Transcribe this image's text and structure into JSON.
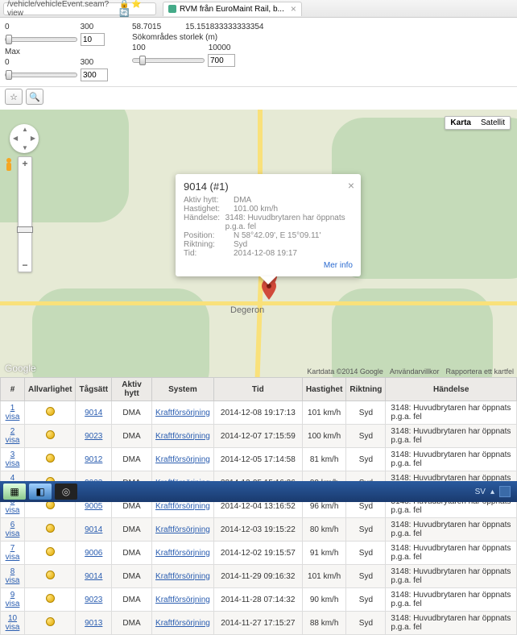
{
  "browser": {
    "url": "/vehicle/vehicleEvent.seam?view",
    "tab_title": "RVM från EuroMaint Rail, b..."
  },
  "controls": {
    "range1_min": "0",
    "range1_max": "300",
    "max_label": "Max",
    "range2_min": "0",
    "range2_max": "300",
    "small_box1": "10",
    "small_box2": "300",
    "area_label": "Sökområdes storlek (m)",
    "area_min": "100",
    "area_max": "10000",
    "area_val": "700",
    "coord_top": "58.7015",
    "coord_top2": "15.151833333333354"
  },
  "map": {
    "type_map": "Karta",
    "type_sat": "Satellit",
    "place": "Degeron",
    "logo": "Google",
    "footer_data": "Kartdata ©2014 Google",
    "footer_terms": "Användarvillkor",
    "footer_report": "Rapportera ett kartfel"
  },
  "info": {
    "title": "9014 (#1)",
    "k_hytt": "Aktiv hytt:",
    "v_hytt": "DMA",
    "k_speed": "Hastighet:",
    "v_speed": "101.00 km/h",
    "k_event": "Händelse:",
    "v_event": "3148: Huvudbrytaren har öppnats p.g.a. fel",
    "k_pos": "Position:",
    "v_pos": "N 58°42.09', E 15°09.11'",
    "k_dir": "Riktning:",
    "v_dir": "Syd",
    "k_time": "Tid:",
    "v_time": "2014-12-08 19:17",
    "more": "Mer info"
  },
  "table": {
    "headers": {
      "num": "#",
      "sev": "Allvarlighet",
      "tag": "Tågsätt",
      "hytt": "Aktiv hytt",
      "sys": "System",
      "tid": "Tid",
      "hast": "Hastighet",
      "rikt": "Riktning",
      "hand": "Händelse"
    },
    "rows": [
      {
        "n": "1 visa",
        "tag": "9014",
        "hytt": "DMA",
        "sys": "Kraftförsörjning",
        "tid": "2014-12-08 19:17:13",
        "hast": "101 km/h",
        "rikt": "Syd",
        "hand": "3148: Huvudbrytaren har öppnats p.g.a. fel"
      },
      {
        "n": "2 visa",
        "tag": "9023",
        "hytt": "DMA",
        "sys": "Kraftförsörjning",
        "tid": "2014-12-07 17:15:59",
        "hast": "100 km/h",
        "rikt": "Syd",
        "hand": "3148: Huvudbrytaren har öppnats p.g.a. fel"
      },
      {
        "n": "3 visa",
        "tag": "9012",
        "hytt": "DMA",
        "sys": "Kraftförsörjning",
        "tid": "2014-12-05 17:14:58",
        "hast": "81 km/h",
        "rikt": "Syd",
        "hand": "3148: Huvudbrytaren har öppnats p.g.a. fel"
      },
      {
        "n": "4 visa",
        "tag": "9023",
        "hytt": "DMA",
        "sys": "Kraftförsörjning",
        "tid": "2014-12-05 15:16:26",
        "hast": "90 km/h",
        "rikt": "Syd",
        "hand": "3148: Huvudbrytaren har öppnats p.g.a. fel"
      },
      {
        "n": "5 visa",
        "tag": "9005",
        "hytt": "DMA",
        "sys": "Kraftförsörjning",
        "tid": "2014-12-04 13:16:52",
        "hast": "96 km/h",
        "rikt": "Syd",
        "hand": "3148: Huvudbrytaren har öppnats p.g.a. fel"
      },
      {
        "n": "6 visa",
        "tag": "9014",
        "hytt": "DMA",
        "sys": "Kraftförsörjning",
        "tid": "2014-12-03 19:15:22",
        "hast": "80 km/h",
        "rikt": "Syd",
        "hand": "3148: Huvudbrytaren har öppnats p.g.a. fel"
      },
      {
        "n": "7 visa",
        "tag": "9006",
        "hytt": "DMA",
        "sys": "Kraftförsörjning",
        "tid": "2014-12-02 19:15:57",
        "hast": "91 km/h",
        "rikt": "Syd",
        "hand": "3148: Huvudbrytaren har öppnats p.g.a. fel"
      },
      {
        "n": "8 visa",
        "tag": "9014",
        "hytt": "DMA",
        "sys": "Kraftförsörjning",
        "tid": "2014-11-29 09:16:32",
        "hast": "101 km/h",
        "rikt": "Syd",
        "hand": "3148: Huvudbrytaren har öppnats p.g.a. fel"
      },
      {
        "n": "9 visa",
        "tag": "9023",
        "hytt": "DMA",
        "sys": "Kraftförsörjning",
        "tid": "2014-11-28 07:14:32",
        "hast": "90 km/h",
        "rikt": "Syd",
        "hand": "3148: Huvudbrytaren har öppnats p.g.a. fel"
      },
      {
        "n": "10 visa",
        "tag": "9013",
        "hytt": "DMA",
        "sys": "Kraftförsörjning",
        "tid": "2014-11-27 17:15:27",
        "hast": "88 km/h",
        "rikt": "Syd",
        "hand": "3148: Huvudbrytaren har öppnats p.g.a. fel"
      }
    ]
  },
  "taskbar": {
    "lang": "SV"
  }
}
